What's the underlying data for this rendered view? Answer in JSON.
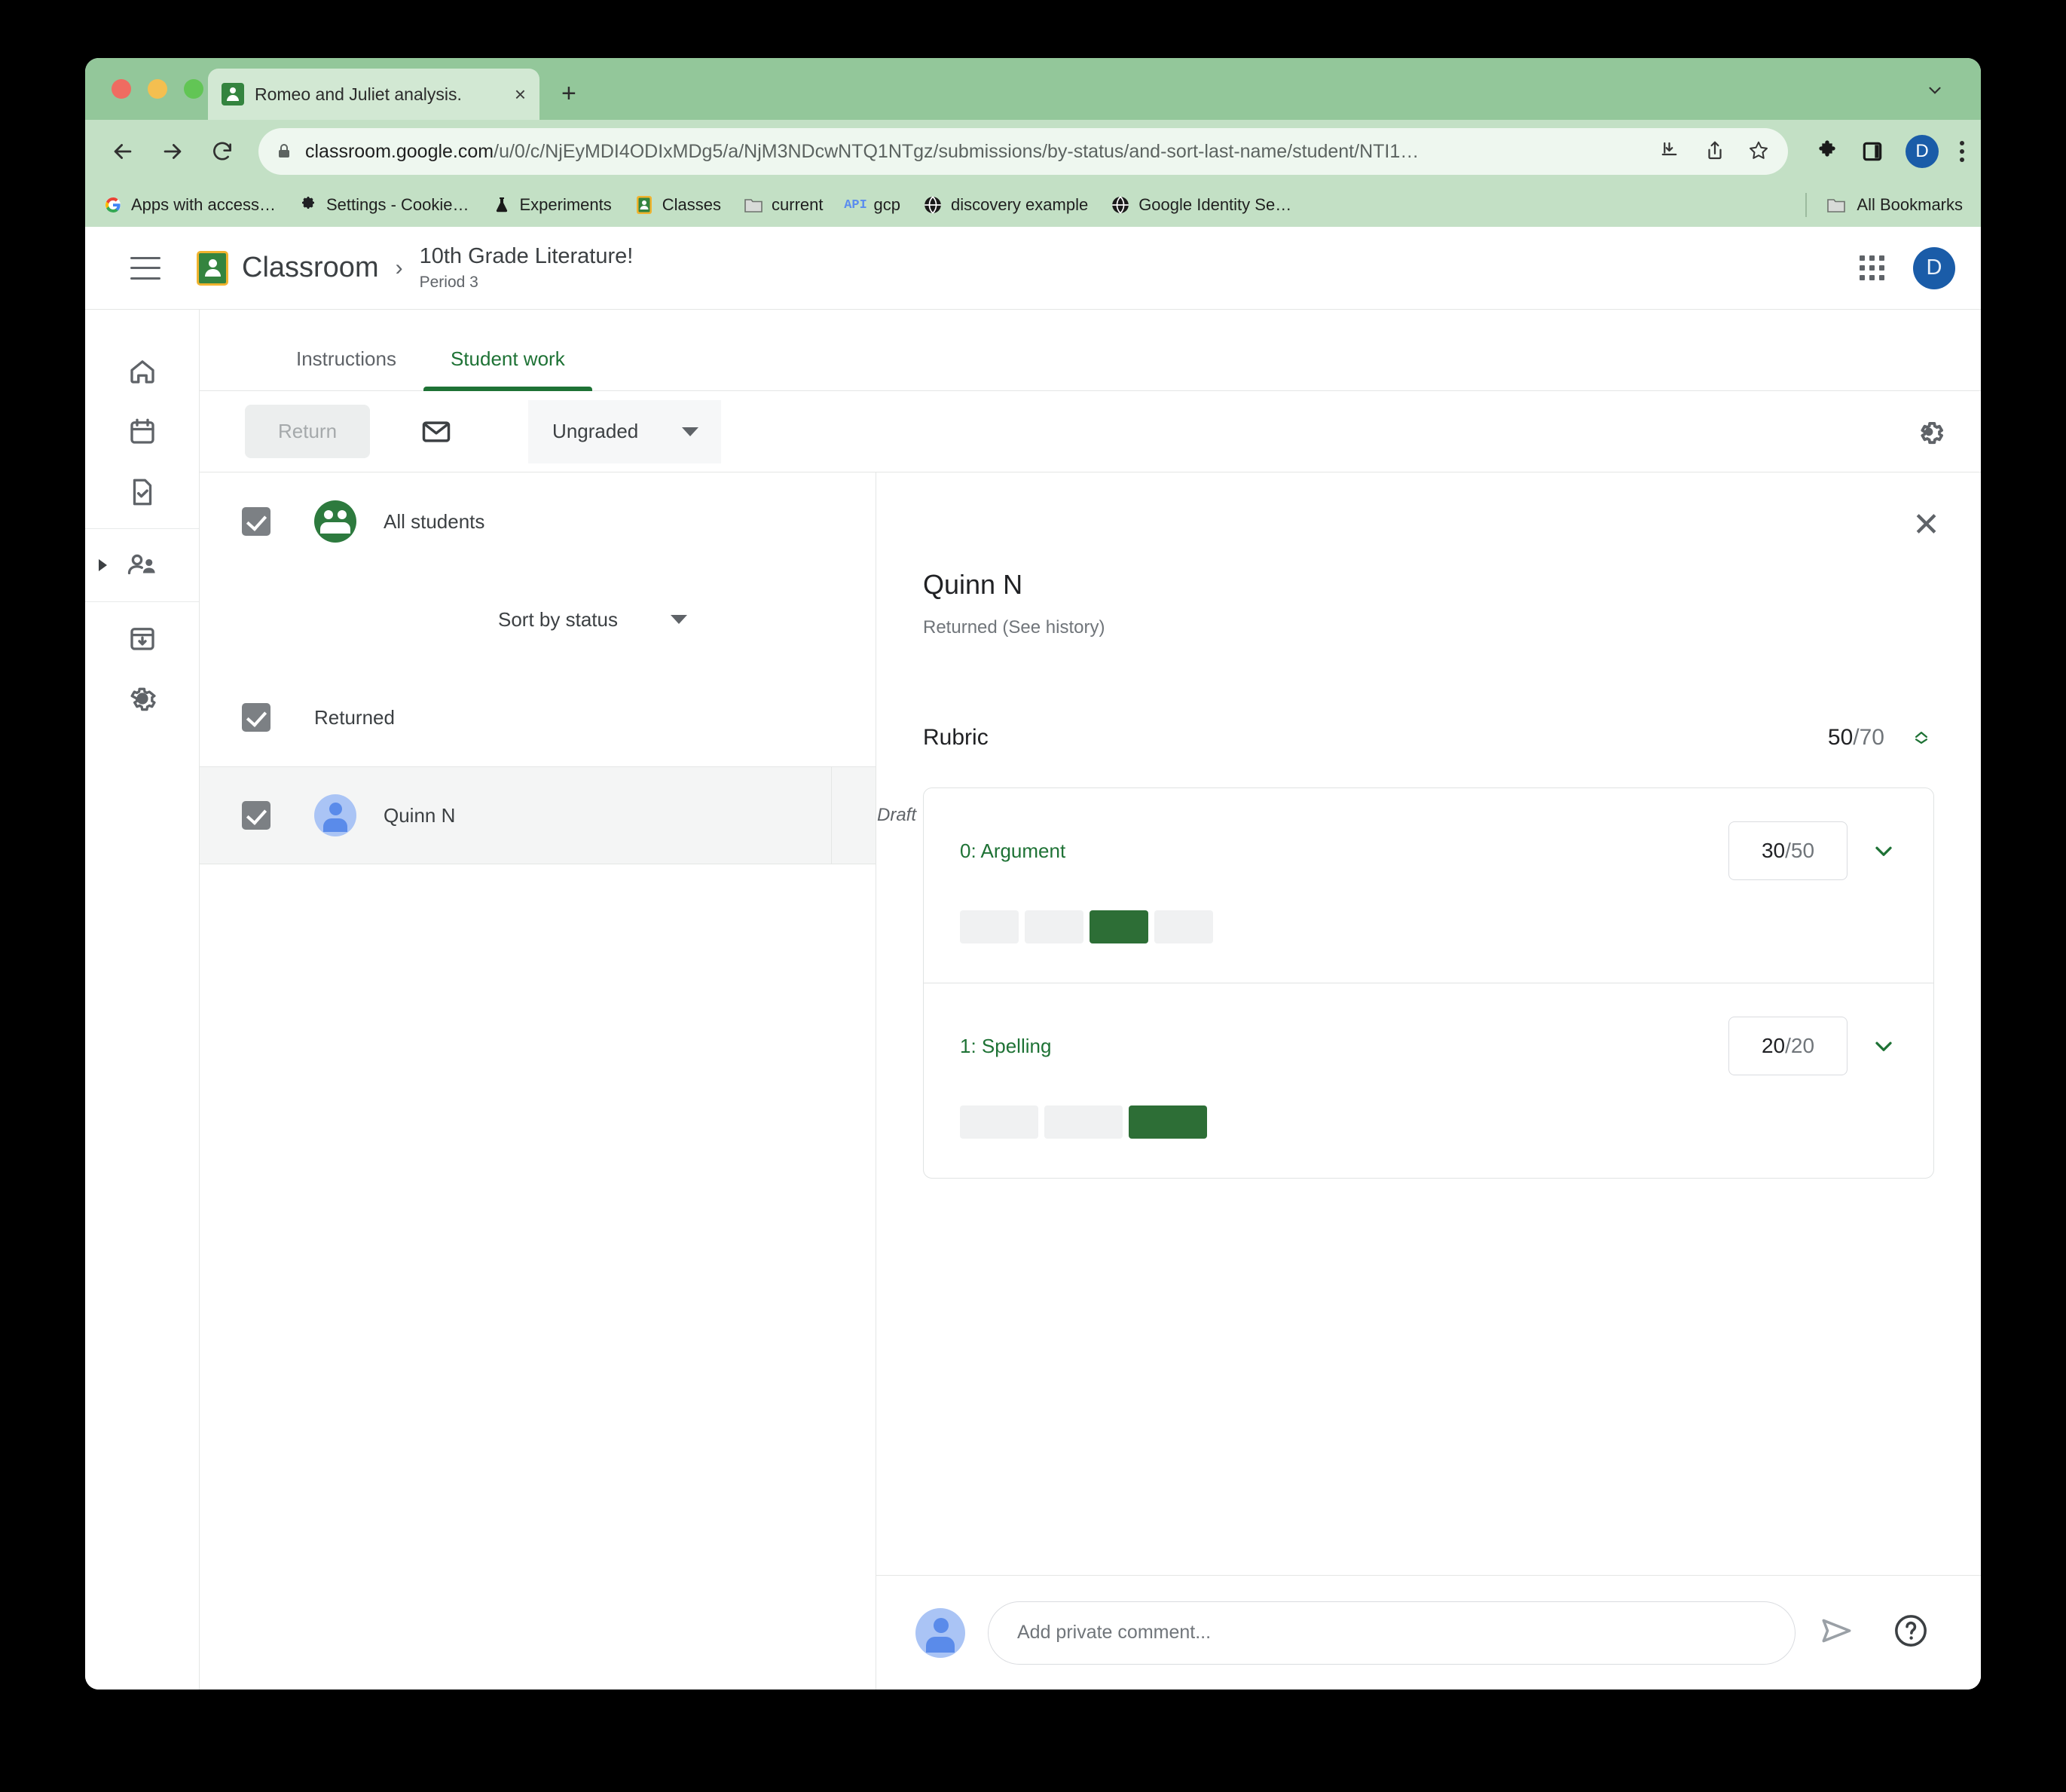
{
  "browser": {
    "tab_title": "Romeo and Juliet analysis.",
    "tab_favicon_icon": "classroom-icon",
    "close_tab_label": "×",
    "new_tab_label": "+",
    "url_prefix": "classroom.google.com",
    "url_path": "/u/0/c/NjEyMDI4ODIxMDg5/a/NjM3NDcwNTQ1NTgz/submissions/by-status/and-sort-last-name/student/NTI1…",
    "back_icon": "back-arrow-icon",
    "forward_icon": "forward-arrow-icon",
    "reload_icon": "reload-icon",
    "lock_icon": "lock-icon",
    "profile_initial": "D",
    "bookmarks": [
      {
        "label": "Apps with access…",
        "icon": "google-icon"
      },
      {
        "label": "Settings - Cookie…",
        "icon": "gear-icon"
      },
      {
        "label": "Experiments",
        "icon": "flask-icon"
      },
      {
        "label": "Classes",
        "icon": "classroom-icon"
      },
      {
        "label": "current",
        "icon": "folder-icon"
      },
      {
        "label": "gcp",
        "icon": "api-icon"
      },
      {
        "label": "discovery example",
        "icon": "globe-icon"
      },
      {
        "label": "Google Identity Se…",
        "icon": "globe-icon"
      }
    ],
    "all_bookmarks_label": "All Bookmarks",
    "all_bookmarks_icon": "folder-icon"
  },
  "app": {
    "menu_icon": "hamburger-menu-icon",
    "logo_icon": "google-classroom-logo",
    "product_name": "Classroom",
    "breadcrumb_separator": "›",
    "course_title": "10th Grade Literature!",
    "course_section": "Period 3",
    "apps_grid_icon": "apps-grid-icon",
    "account_initial": "D"
  },
  "rail": {
    "items": [
      {
        "name": "home",
        "icon": "home-icon",
        "active": false
      },
      {
        "name": "calendar",
        "icon": "calendar-icon",
        "active": false
      },
      {
        "name": "to-review",
        "icon": "document-check-icon",
        "active": false
      },
      {
        "name": "enrolled-classes",
        "icon": "people-icon",
        "active": true
      },
      {
        "name": "archived-classes",
        "icon": "archive-icon",
        "active": false
      },
      {
        "name": "settings",
        "icon": "gear-icon",
        "active": false
      }
    ]
  },
  "tabs": [
    {
      "label": "Instructions",
      "active": false
    },
    {
      "label": "Student work",
      "active": true
    }
  ],
  "toolbar": {
    "return_label": "Return",
    "mail_icon": "envelope-icon",
    "grade_filter_value": "Ungraded",
    "grade_filter_caret_icon": "chevron-down-icon",
    "settings_icon": "gear-icon"
  },
  "list_pane": {
    "all_students_label": "All students",
    "all_students_icon": "group-avatar-icon",
    "all_students_checked": true,
    "sort_label": "Sort by status",
    "sort_caret_icon": "chevron-down-icon",
    "status_group_label": "Returned",
    "status_group_checked": true,
    "students": [
      {
        "name": "Quinn N",
        "status": "Draft",
        "checked": true,
        "avatar_icon": "person-avatar-icon",
        "selected": true
      }
    ]
  },
  "detail": {
    "close_icon": "close-icon",
    "close_label": "✕",
    "student_name": "Quinn N",
    "student_status": "Returned (See history)",
    "rubric_label": "Rubric",
    "rubric_score_earned": "50",
    "rubric_score_total": "/70",
    "rubric_toggle_icon": "expand-collapse-icon",
    "criteria": [
      {
        "title": "0: Argument",
        "points_earned": "30",
        "points_total": "/50",
        "chevron_icon": "chevron-down-icon",
        "levels": 4,
        "selected_level": 3,
        "level_widths": [
          78,
          78,
          78,
          78
        ]
      },
      {
        "title": "1: Spelling",
        "points_earned": "20",
        "points_total": "/20",
        "chevron_icon": "chevron-down-icon",
        "levels": 3,
        "selected_level": 3,
        "level_widths": [
          104,
          104,
          104
        ]
      }
    ]
  },
  "comment": {
    "avatar_icon": "person-avatar-icon",
    "placeholder": "Add private comment...",
    "send_icon": "send-icon",
    "help_icon": "help-circle-icon"
  },
  "colors": {
    "classroom_green": "#1e7235",
    "rubric_fill": "#2d6e36",
    "chrome_theme": "#c3e0c5",
    "avatar_blue": "#1a5ca8"
  }
}
